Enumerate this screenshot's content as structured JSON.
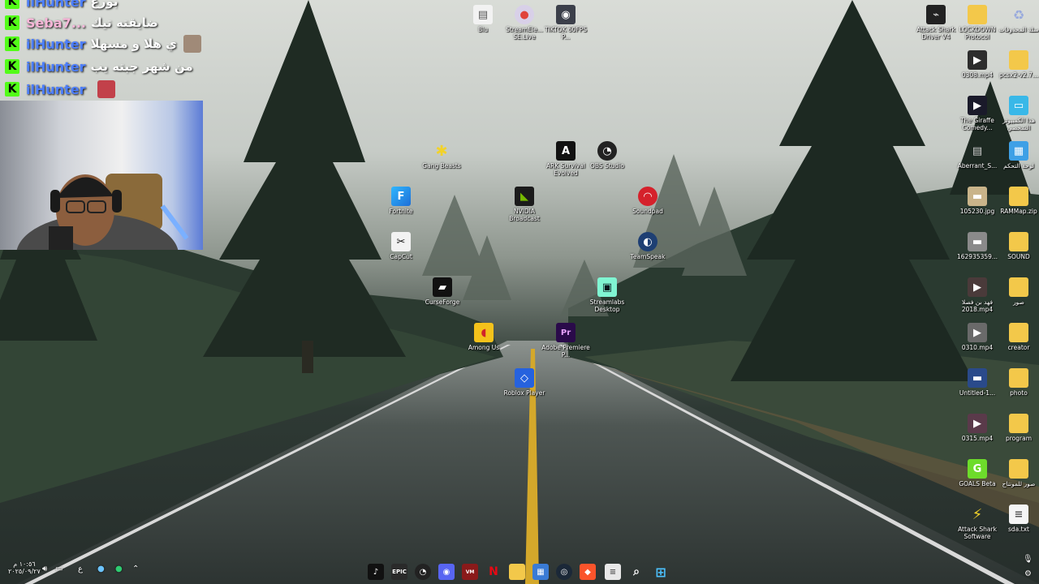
{
  "chat": {
    "messages": [
      {
        "user": "ilHunter",
        "text": "بورع",
        "pink": false
      },
      {
        "user": "Seba7...",
        "text": "ضايقته تيك",
        "pink": true
      },
      {
        "user": "ilHunter",
        "text": "ي هلا و مسهلا",
        "pink": false
      },
      {
        "user": "ilHunter",
        "text": "من شهر جبته يب",
        "pink": false
      },
      {
        "user": "ilHunter",
        "text": "",
        "pink": false
      }
    ]
  },
  "desktop_icons": {
    "blu": "Blu",
    "streamelements": "StreamEle... SE.Live",
    "tiktok": "TIKTOK 60FPS P...",
    "gangbeasts": "Gang Beasts",
    "ark": "ARK Survival Evolved",
    "obs": "OBS Studio",
    "fortnite": "Fortnite",
    "nvidia": "NVIDIA Broadcast",
    "soundpad": "Soundpad",
    "capcut": "CapCut",
    "teamspeak": "TeamSpeak",
    "curseforge": "CurseForge",
    "streamlabs": "Streamlabs Desktop",
    "amongus": "Among Us",
    "premiere": "Adobe Premiere P...",
    "roblox": "Roblox Player"
  },
  "right_icons": [
    [
      "Attack Shark Driver V4",
      "LOCKDOWN Protocol",
      "سلة المحذوفات"
    ],
    [
      "0308.mp4",
      "pcsx2-v2.7..."
    ],
    [
      "The Giraffe Comedy...",
      "هذا الكمبيوتر الشخصي"
    ],
    [
      "Aberrant_S...",
      "لوحة التحكم"
    ],
    [
      "105230.jpg",
      "RAMMap.zip"
    ],
    [
      "162935359...",
      "SOUND"
    ],
    [
      "فهد بن فصلا 2018.mp4",
      "صور"
    ],
    [
      "0310.mp4",
      "creator"
    ],
    [
      "Untitled-1...",
      "photo"
    ],
    [
      "0315.mp4",
      "program"
    ],
    [
      "GOALS Beta",
      "صور للمونتاج"
    ],
    [
      "Attack Shark Software",
      "sda.txt"
    ]
  ],
  "taskbar": {
    "clock_time": "١٠:٥٦ م",
    "clock_date": "٢٠٢٥/٠٩/٢٧",
    "lang": "ع",
    "apps": [
      "tiktok-live",
      "epic-games",
      "obs",
      "discord",
      "voicemeeter",
      "netflix",
      "explorer",
      "store",
      "steam",
      "brave",
      "notepad",
      "search",
      "start"
    ]
  },
  "colors": {
    "kick_green": "#53fc18",
    "username_blue": "#4d7fff"
  }
}
